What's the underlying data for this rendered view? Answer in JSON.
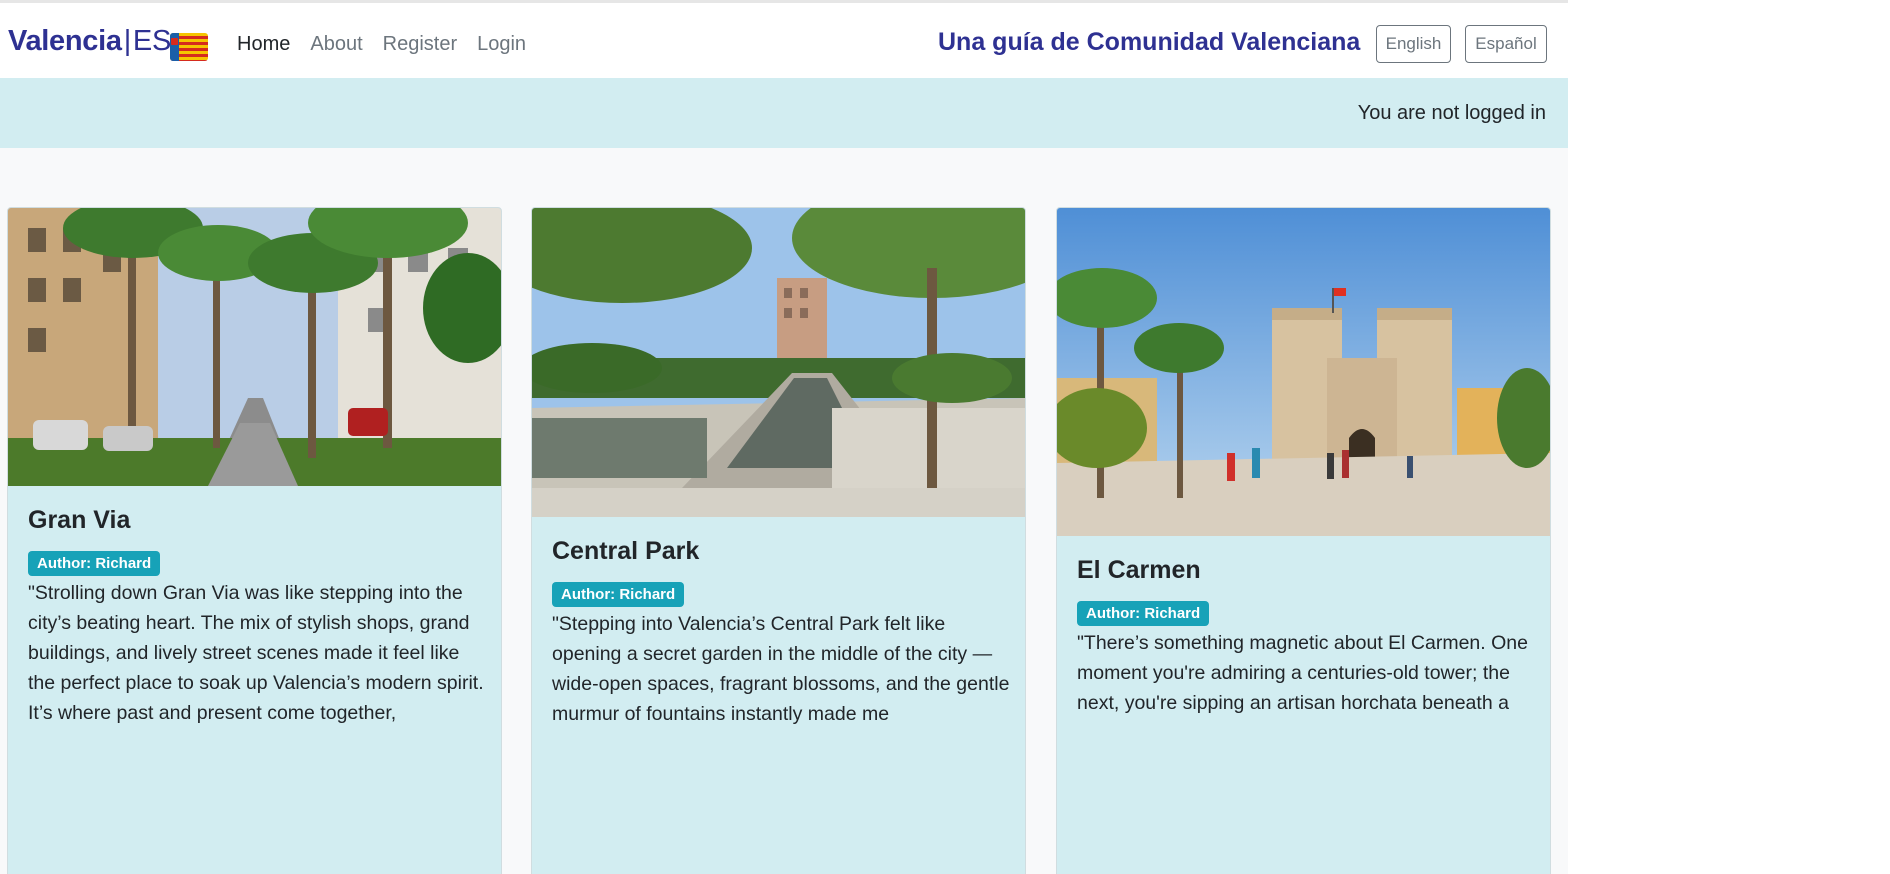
{
  "brand": {
    "part1": "Valencia",
    "separator": "|",
    "part2": "ES"
  },
  "nav": {
    "links": [
      {
        "label": "Home"
      },
      {
        "label": "About"
      },
      {
        "label": "Register"
      },
      {
        "label": "Login"
      }
    ]
  },
  "header": {
    "tagline": "Una guía de Comunidad Valenciana",
    "tagline_sep": "|",
    "lang_en": "English",
    "lang_es": "Español"
  },
  "status": {
    "text": "You are not logged in"
  },
  "cards": [
    {
      "title": "Gran Via",
      "author": "Author: Richard",
      "text": "\"Strolling down Gran Via was like stepping into the city’s beating heart. The mix of stylish shops, grand buildings, and lively street scenes made it feel like the perfect place to soak up Valencia’s modern spirit. It’s where past and present come together,"
    },
    {
      "title": "Central Park",
      "author": "Author: Richard",
      "text": "\"Stepping into Valencia’s Central Park felt like opening a secret garden in the middle of the city — wide-open spaces, fragrant blossoms, and the gentle murmur of fountains instantly made me"
    },
    {
      "title": "El Carmen",
      "author": "Author: Richard",
      "text": "\"There’s something magnetic about El Carmen. One moment you're admiring a centuries-old tower; the next, you're sipping an artisan horchata beneath a"
    }
  ]
}
